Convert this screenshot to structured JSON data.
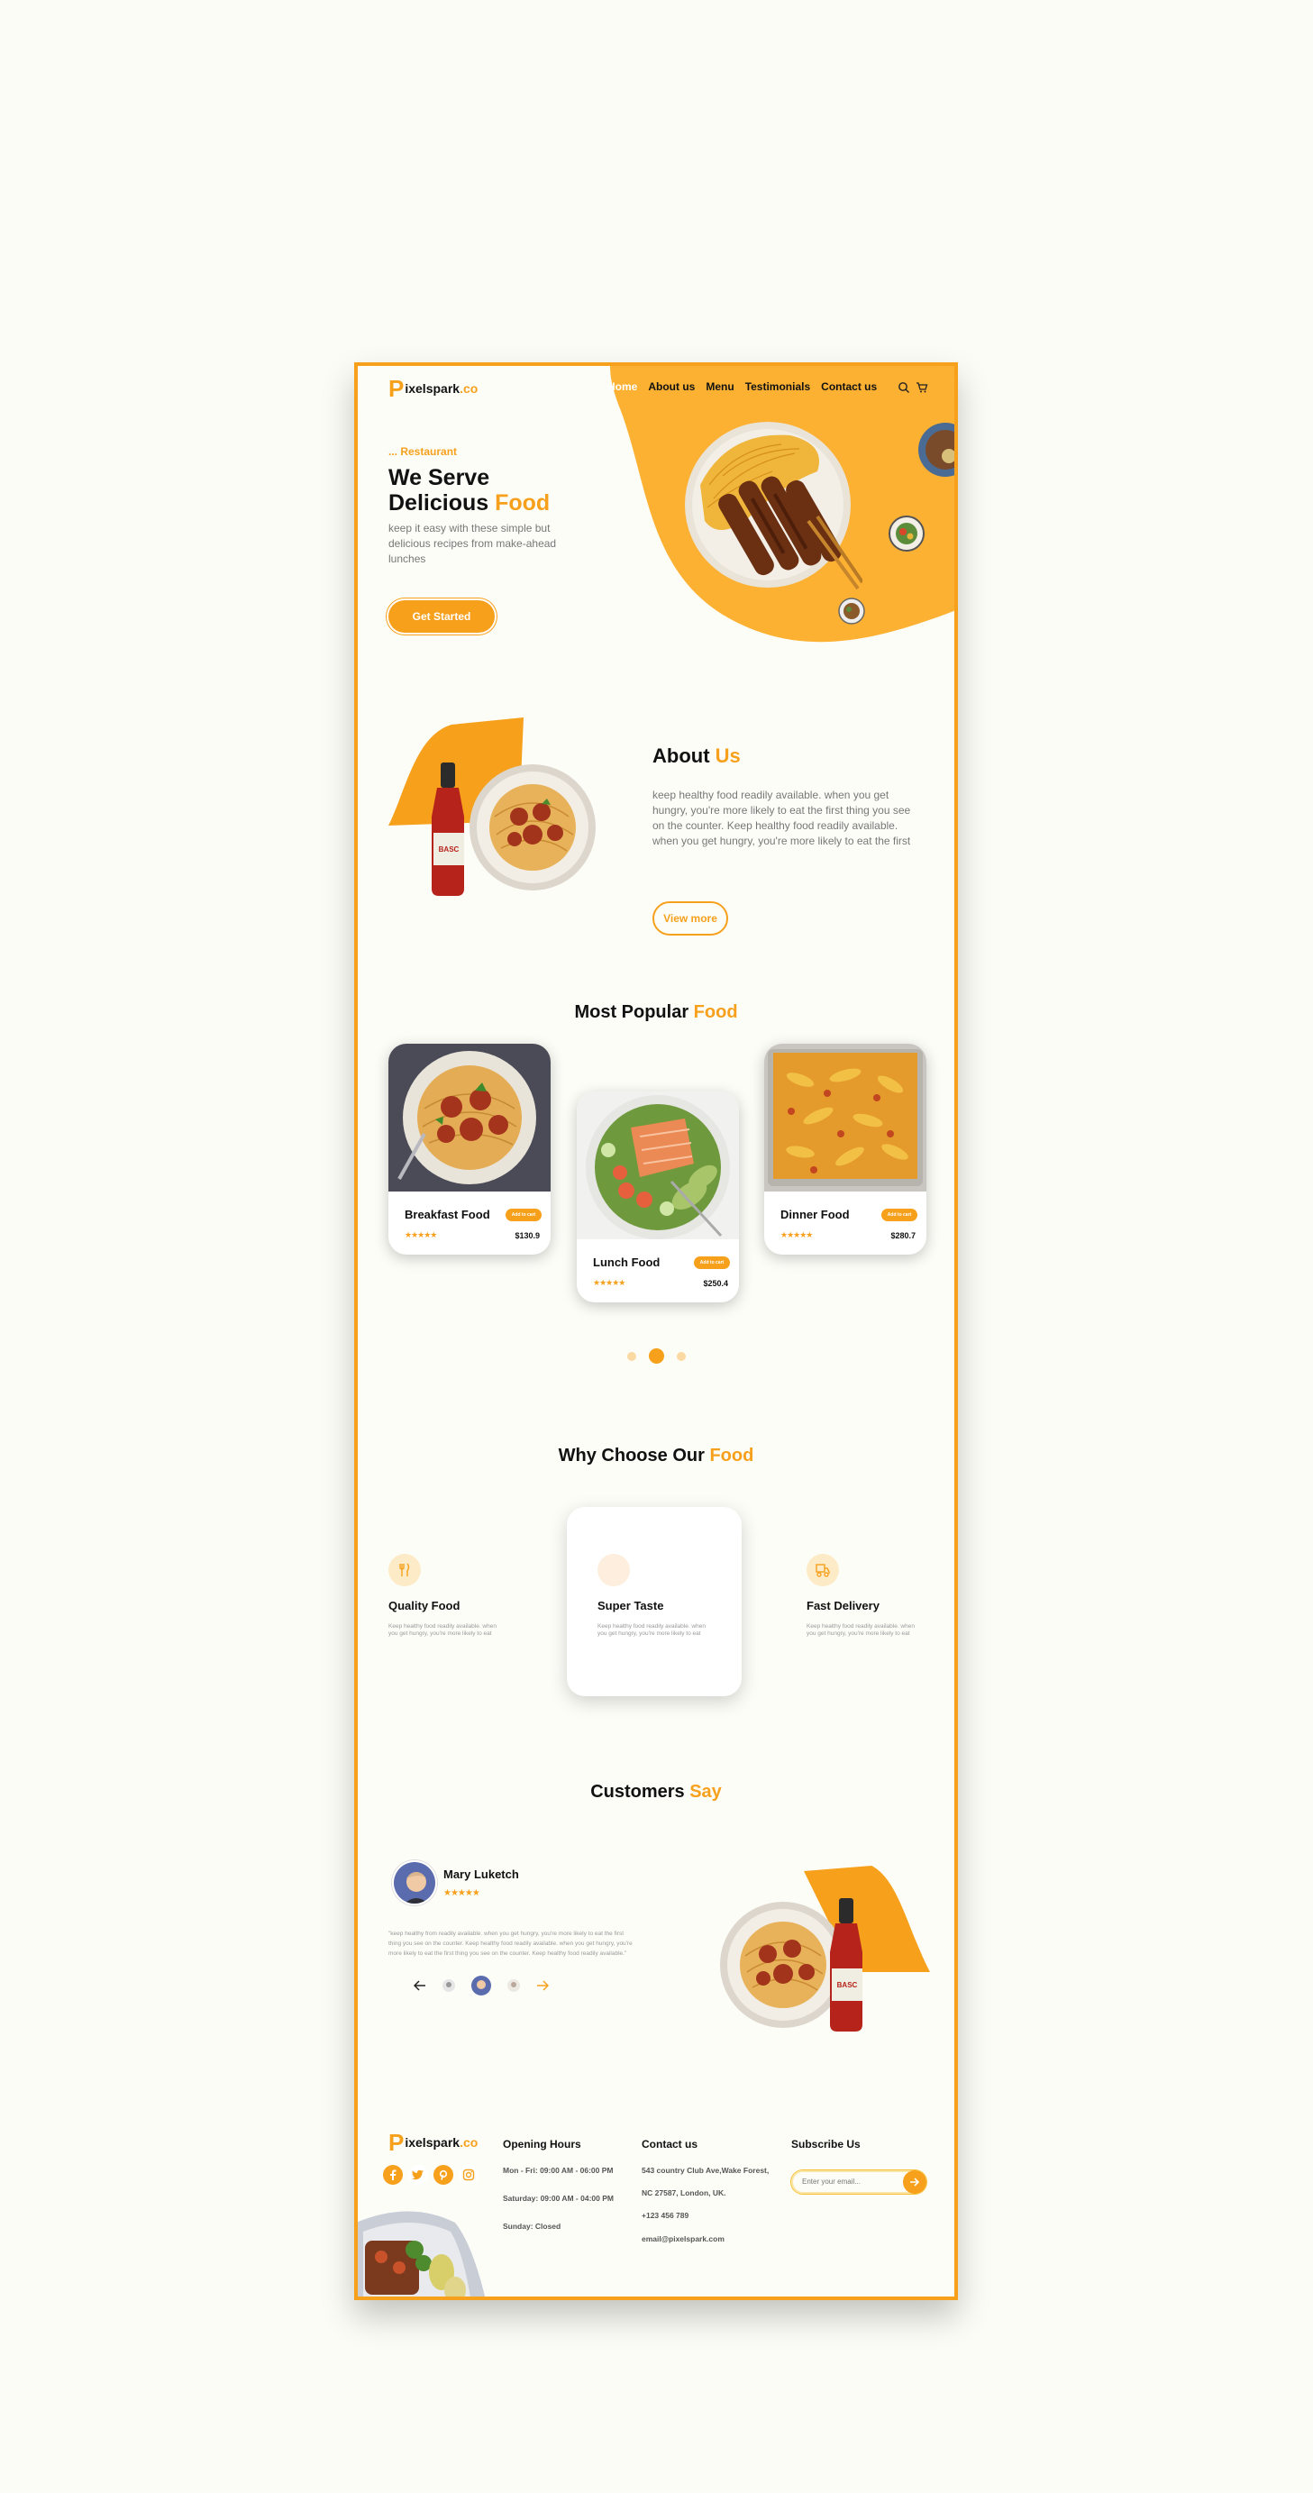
{
  "brand": {
    "prefix": "P",
    "name": "ixelspark",
    "suffix": ".co"
  },
  "nav": {
    "items": [
      "Home",
      "About us",
      "Menu",
      "Testimonials",
      "Contact us"
    ],
    "active": "Home"
  },
  "icons": {
    "search": "search-icon",
    "cart": "cart-icon"
  },
  "hero": {
    "tag": "... Restaurant",
    "title_line1": "We Serve",
    "title_line2_plain": "Delicious ",
    "title_line2_accent": "Food",
    "subtitle": "keep it easy with these simple but delicious recipes from make-ahead lunches",
    "cta": "Get Started"
  },
  "about": {
    "title_plain": "About ",
    "title_accent": "Us",
    "text": "keep healthy food readily available. when you get hungry, you're more likely to eat the first thing you see on the counter. Keep healthy food readily available. when you get hungry, you're more likely to eat the first",
    "cta": "View more"
  },
  "popular": {
    "title_plain": "Most Popular ",
    "title_accent": "Food",
    "cards": [
      {
        "name": "Breakfast Food",
        "add": "Add to cart",
        "stars": "★★★★★",
        "price": "$130.9"
      },
      {
        "name": "Lunch Food",
        "add": "Add to cart",
        "stars": "★★★★★",
        "price": "$250.4"
      },
      {
        "name": "Dinner Food",
        "add": "Add to cart",
        "stars": "★★★★★",
        "price": "$280.7"
      }
    ],
    "active_dot": 2
  },
  "why": {
    "title_plain": "Why Choose Our ",
    "title_accent": "Food",
    "features": [
      {
        "title": "Quality Food",
        "text": "Keep healthy food readily available. when you get hungry, you're more likely to eat",
        "icon": "utensils-icon"
      },
      {
        "title": "Super Taste",
        "text": "Keep healthy food readily available. when you get hungry, you're more likely to eat",
        "icon": "taste-icon"
      },
      {
        "title": "Fast Delivery",
        "text": "Keep healthy food readily available. when you get hungry, you're more likely to eat",
        "icon": "delivery-icon"
      }
    ]
  },
  "testimonials": {
    "title_plain": "Customers ",
    "title_accent": "Say",
    "name": "Mary  Luketch",
    "stars": "★★★★★",
    "text": "\"keep healthy from readily available. when you get hungry, you're more likely to eat the first thing you see on the counter. Keep healthy food readily available. when you get hungry, you're more likely to eat the first thing you see on the counter. Keep healthy food readily available.\""
  },
  "footer": {
    "hours_title": "Opening Hours",
    "hours": [
      "Mon - Fri: 09:00 AM - 06:00 PM",
      "Saturday: 09:00 AM - 04:00 PM",
      "Sunday: Closed"
    ],
    "contact_title": "Contact us",
    "contact": [
      "543 country Club Ave,Wake Forest,",
      "NC 27587, London, UK.",
      "+123 456 789",
      "email@pixelspark.com"
    ],
    "subscribe_title": "Subscribe Us",
    "subscribe_placeholder": "Enter your email...",
    "social": [
      "facebook-icon",
      "twitter-icon",
      "pinterest-icon",
      "instagram-icon"
    ]
  },
  "colors": {
    "accent": "#f6a01c",
    "background": "#fdfdf8",
    "text": "#111111",
    "muted": "#777777"
  }
}
